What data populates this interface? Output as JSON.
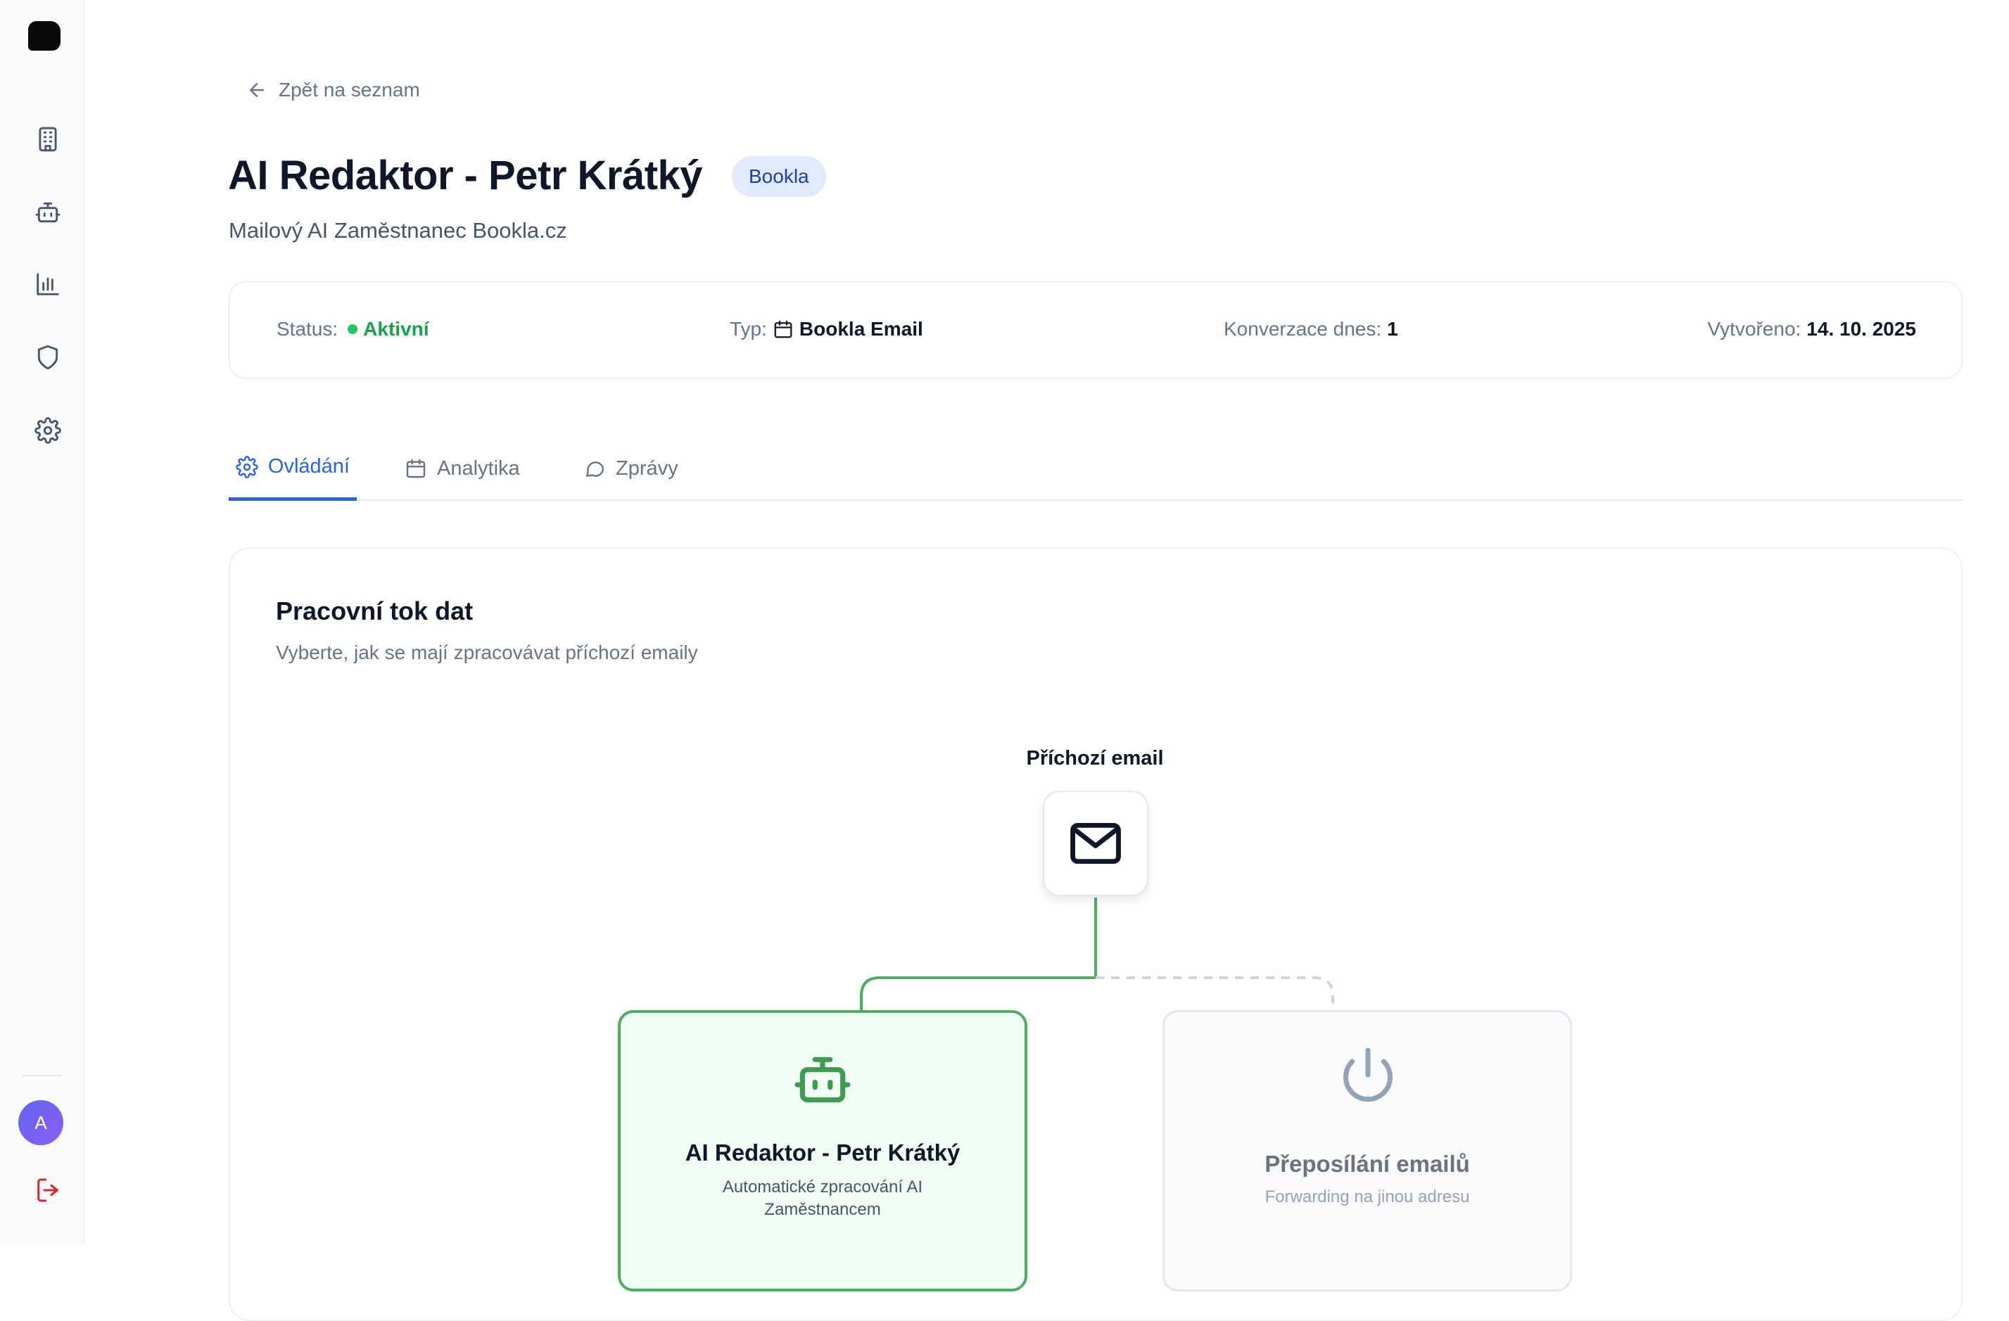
{
  "sidebar": {
    "items": [
      {
        "icon": "building-icon"
      },
      {
        "icon": "bot-icon"
      },
      {
        "icon": "bar-chart-icon"
      },
      {
        "icon": "shield-icon"
      },
      {
        "icon": "gear-icon"
      }
    ],
    "avatar_initial": "A",
    "logout_icon": "logout-icon"
  },
  "header": {
    "back_label": "Zpět na seznam",
    "title": "AI Redaktor - Petr Krátký",
    "badge": "Bookla",
    "subtitle": "Mailový AI Zaměstnanec Bookla.cz"
  },
  "info": {
    "status_label": "Status:",
    "status_value": "Aktivní",
    "type_label": "Typ:",
    "type_value": "Bookla Email",
    "conversations_label": "Konverzace dnes:",
    "conversations_value": "1",
    "created_label": "Vytvořeno:",
    "created_value": "14. 10. 2025"
  },
  "tabs": [
    {
      "label": "Ovládání",
      "icon": "gear-icon",
      "active": true
    },
    {
      "label": "Analytika",
      "icon": "calendar-icon",
      "active": false
    },
    {
      "label": "Zprávy",
      "icon": "chat-bubble-icon",
      "active": false
    }
  ],
  "workflow": {
    "title": "Pracovní tok dat",
    "description": "Vyberte, jak se mají zpracovávat příchozí emaily",
    "incoming_label": "Příchozí email",
    "ai_node": {
      "title": "AI Redaktor - Petr Krátký",
      "description": "Automatické zpracování AI Zaměstnancem"
    },
    "forward_node": {
      "title": "Přeposílání emailů",
      "description": "Forwarding na jinou adresu"
    }
  },
  "colors": {
    "accent": "#2563eb",
    "active_green": "#16a34a",
    "ai_border": "#4caf60",
    "ai_bg": "#f0fdf4",
    "badge_bg": "#e0eafc"
  }
}
